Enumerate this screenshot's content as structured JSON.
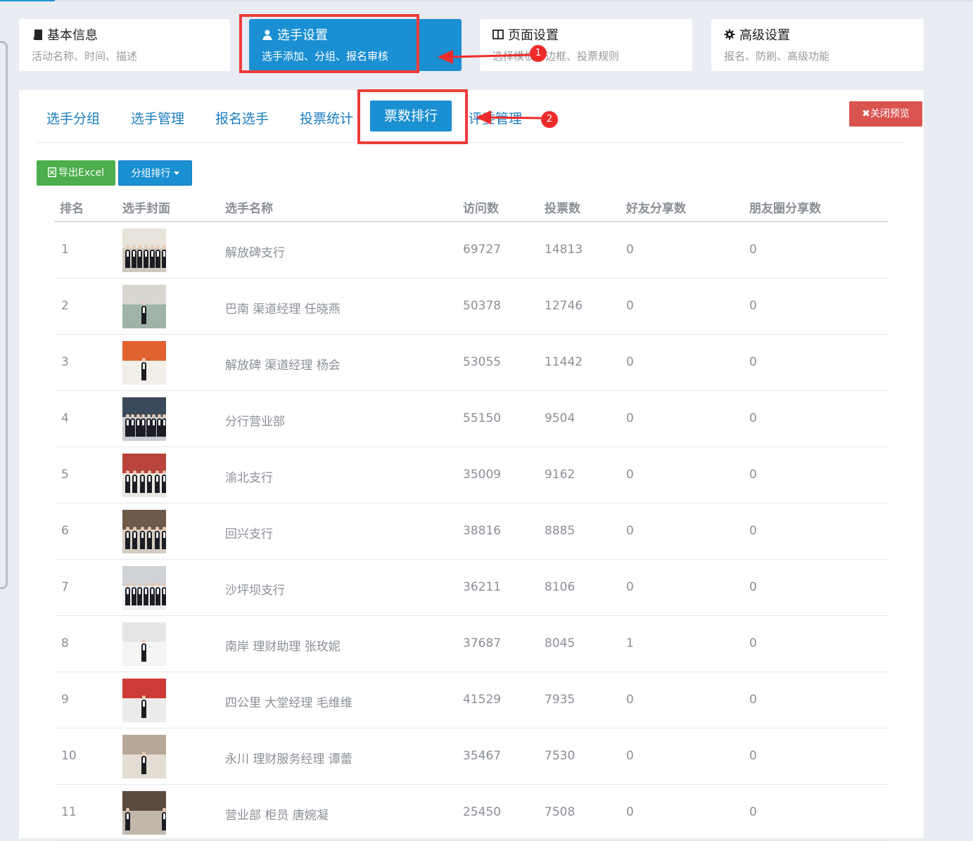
{
  "cards": [
    {
      "title": "基本信息",
      "subtitle": "活动名称、时间、描述",
      "icon": "book-icon"
    },
    {
      "title": "选手设置",
      "subtitle": "选手添加、分组、报名审核",
      "icon": "user-icon"
    },
    {
      "title": "页面设置",
      "subtitle": "选择模板、边框、投票规则",
      "icon": "columns-icon"
    },
    {
      "title": "高级设置",
      "subtitle": "报名、防刷、高级功能",
      "icon": "gear-icon"
    }
  ],
  "tabs": [
    "选手分组",
    "选手管理",
    "报名选手",
    "投票统计",
    "票数排行",
    "评委管理"
  ],
  "active_tab": "票数排行",
  "buttons": {
    "close_preview": "关闭预览",
    "export_excel": "导出Excel",
    "group_rank": "分组排行"
  },
  "table": {
    "headers": [
      "排名",
      "选手封面",
      "选手名称",
      "访问数",
      "投票数",
      "好友分享数",
      "朋友圈分享数"
    ],
    "rows": [
      {
        "rank": "1",
        "name": "解放碑支行",
        "visits": "69727",
        "votes": "14813",
        "friend_shares": "0",
        "moment_shares": "0"
      },
      {
        "rank": "2",
        "name": "巴南 渠道经理 任晓燕",
        "visits": "50378",
        "votes": "12746",
        "friend_shares": "0",
        "moment_shares": "0"
      },
      {
        "rank": "3",
        "name": "解放碑 渠道经理 杨会",
        "visits": "53055",
        "votes": "11442",
        "friend_shares": "0",
        "moment_shares": "0"
      },
      {
        "rank": "4",
        "name": "分行营业部",
        "visits": "55150",
        "votes": "9504",
        "friend_shares": "0",
        "moment_shares": "0"
      },
      {
        "rank": "5",
        "name": "渝北支行",
        "visits": "35009",
        "votes": "9162",
        "friend_shares": "0",
        "moment_shares": "0"
      },
      {
        "rank": "6",
        "name": "回兴支行",
        "visits": "38816",
        "votes": "8885",
        "friend_shares": "0",
        "moment_shares": "0"
      },
      {
        "rank": "7",
        "name": "沙坪坝支行",
        "visits": "36211",
        "votes": "8106",
        "friend_shares": "0",
        "moment_shares": "0"
      },
      {
        "rank": "8",
        "name": "南岸 理财助理 张玫妮",
        "visits": "37687",
        "votes": "8045",
        "friend_shares": "1",
        "moment_shares": "0"
      },
      {
        "rank": "9",
        "name": "四公里 大堂经理 毛维维",
        "visits": "41529",
        "votes": "7935",
        "friend_shares": "0",
        "moment_shares": "0"
      },
      {
        "rank": "10",
        "name": "永川 理财服务经理 谭蕾",
        "visits": "35467",
        "votes": "7530",
        "friend_shares": "0",
        "moment_shares": "0"
      },
      {
        "rank": "11",
        "name": "营业部 柜员 唐婉凝",
        "visits": "25450",
        "votes": "7508",
        "friend_shares": "0",
        "moment_shares": "0"
      }
    ]
  },
  "annotations": {
    "step1": "1",
    "step2": "2"
  },
  "colors": {
    "primary": "#1a8fd2",
    "danger": "#d9534f",
    "success": "#4cae4c",
    "highlight": "#ee3b3b"
  }
}
